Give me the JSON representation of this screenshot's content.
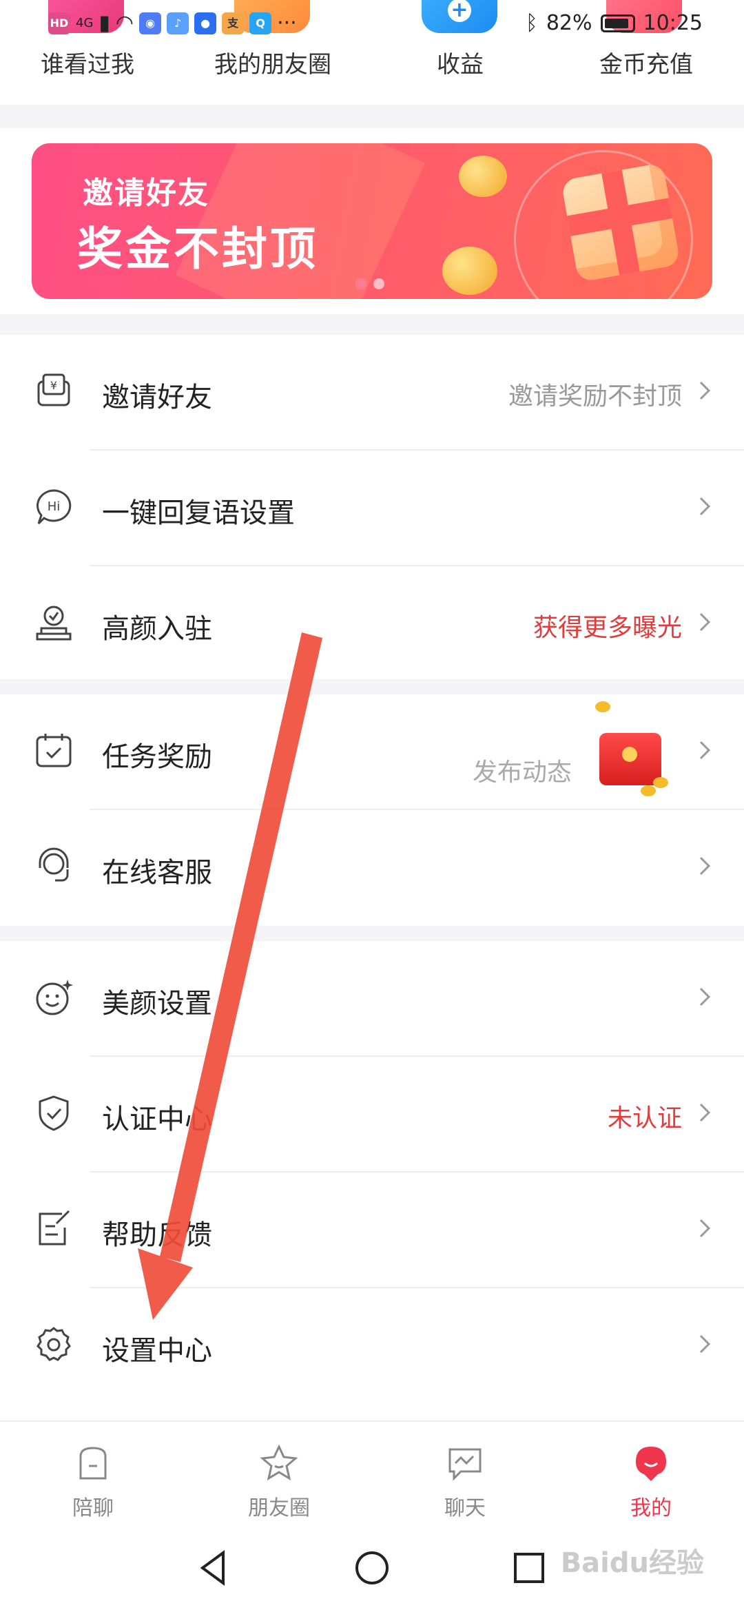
{
  "status_bar": {
    "time": "10:25",
    "battery": "82%",
    "network": "4G"
  },
  "quick_entries": [
    {
      "label": "谁看过我",
      "icon": "eye-icon",
      "color": "#ff5aa0"
    },
    {
      "label": "我的朋友圈",
      "icon": "star-icon",
      "color": "#ffb35a"
    },
    {
      "label": "收益",
      "icon": "plus-icon",
      "color": "#1e8bf0"
    },
    {
      "label": "金币充值",
      "icon": "wallet-icon",
      "color": "#ff4f66"
    }
  ],
  "banner": {
    "subtitle": "邀请好友",
    "title": "奖金不封顶",
    "slides": 2,
    "active_slide": 1
  },
  "menu": {
    "invite": {
      "label": "邀请好友",
      "hint": "邀请奖励不封顶",
      "icon": "yuan-wallet-icon"
    },
    "quick_reply": {
      "label": "一键回复语设置",
      "icon": "hi-bubble-icon"
    },
    "high_face": {
      "label": "高颜入驻",
      "hint": "获得更多曝光",
      "icon": "podium-icon"
    },
    "task": {
      "label": "任务奖励",
      "hint": "发布动态",
      "icon": "calendar-check-icon"
    },
    "service": {
      "label": "在线客服",
      "icon": "headset-icon"
    },
    "beauty": {
      "label": "美颜设置",
      "icon": "smile-sparkle-icon"
    },
    "verify": {
      "label": "认证中心",
      "hint": "未认证",
      "icon": "shield-check-icon"
    },
    "help": {
      "label": "帮助反馈",
      "icon": "note-edit-icon"
    },
    "settings": {
      "label": "设置中心",
      "icon": "gear-icon"
    }
  },
  "tabbar": [
    {
      "label": "陪聊",
      "icon": "chat-face-icon",
      "active": false
    },
    {
      "label": "朋友圈",
      "icon": "star-face-icon",
      "active": false
    },
    {
      "label": "聊天",
      "icon": "message-wave-icon",
      "active": false
    },
    {
      "label": "我的",
      "icon": "profile-icon",
      "active": true
    }
  ],
  "colors": {
    "accent": "#f0364d",
    "hint_red": "#e23b3b",
    "annotation_arrow": "#ef4e3a"
  },
  "watermark": "Baidu经验"
}
